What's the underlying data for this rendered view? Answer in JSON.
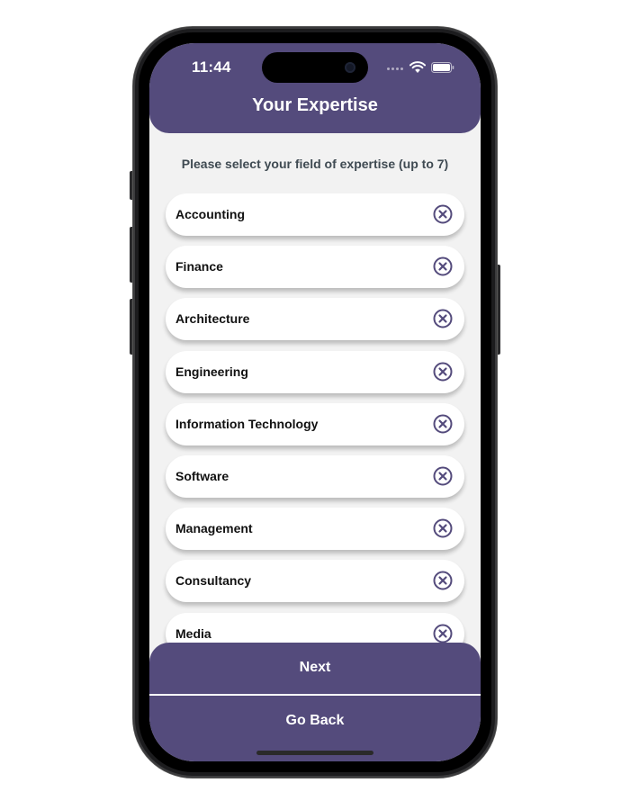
{
  "status_bar": {
    "time": "11:44"
  },
  "header": {
    "title": "Your Expertise"
  },
  "main": {
    "subtitle": "Please select your field of expertise (up to 7)",
    "items": [
      {
        "label": "Accounting",
        "icon": "remove-circle-x-icon"
      },
      {
        "label": "Finance",
        "icon": "remove-circle-x-icon"
      },
      {
        "label": "Architecture",
        "icon": "remove-circle-x-icon"
      },
      {
        "label": "Engineering",
        "icon": "remove-circle-x-icon"
      },
      {
        "label": "Information Technology",
        "icon": "remove-circle-x-icon"
      },
      {
        "label": "Software",
        "icon": "remove-circle-x-icon"
      },
      {
        "label": "Management",
        "icon": "remove-circle-x-icon"
      },
      {
        "label": "Consultancy",
        "icon": "remove-circle-x-icon"
      },
      {
        "label": "Media",
        "icon": "remove-circle-x-icon"
      }
    ]
  },
  "footer": {
    "next_label": "Next",
    "back_label": "Go Back"
  },
  "colors": {
    "primary": "#544b7c",
    "background": "#f2f2f2",
    "card": "#ffffff",
    "subtitle_text": "#3f4a52"
  }
}
